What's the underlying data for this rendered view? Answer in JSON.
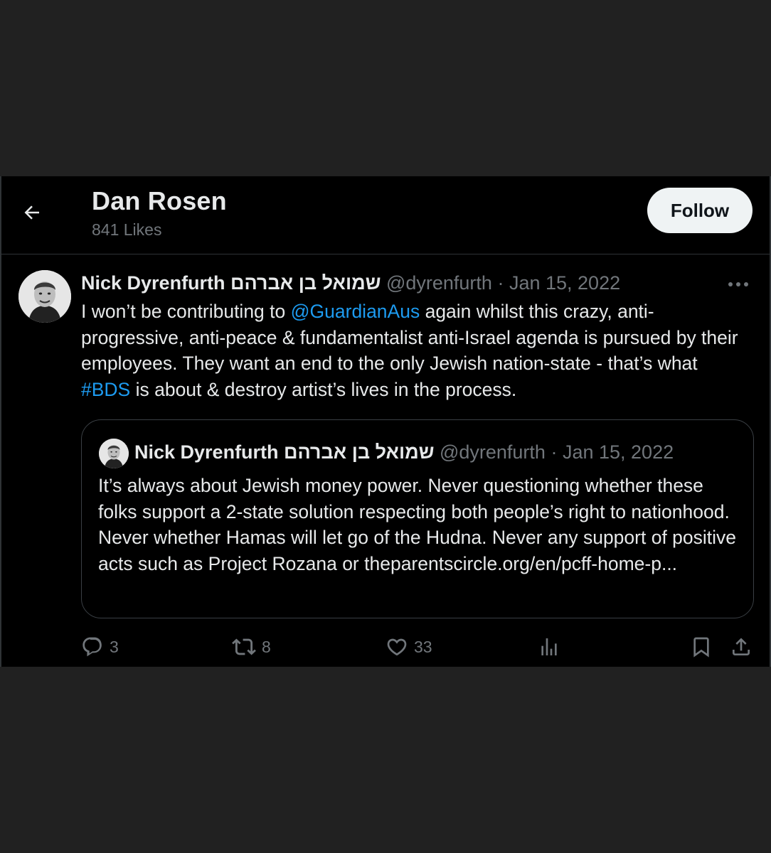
{
  "header": {
    "title": "Dan Rosen",
    "subtitle": "841 Likes",
    "follow_label": "Follow"
  },
  "tweet": {
    "author_name": "Nick Dyrenfurth שמואל בן אברהם",
    "handle": "@dyrenfurth",
    "separator": "·",
    "date": "Jan 15, 2022",
    "text_parts": {
      "p1": "I won’t be contributing to ",
      "mention": "@GuardianAus",
      "p2": "  again whilst this crazy, anti-progressive, anti-peace & fundamentalist anti-Israel agenda is pursued by their employees. They want an end to the only Jewish nation-state - that’s what ",
      "hashtag": "#BDS",
      "p3": " is about & destroy artist’s lives in the process."
    }
  },
  "quote": {
    "author_name": "Nick Dyrenfurth שמואל בן אברהם",
    "handle": "@dyrenfurth",
    "separator": "·",
    "date": "Jan 15, 2022",
    "text": "It’s always about Jewish money power. Never questioning whether these folks support a 2-state solution respecting both people’s right to nationhood. Never whether Hamas will let go of the Hudna. Never any support of positive acts such as Project Rozana or theparentscircle.org/en/pcff-home-p..."
  },
  "actions": {
    "replies": "3",
    "reposts": "8",
    "likes": "33"
  },
  "icons": [
    "back-arrow-icon",
    "more-icon",
    "reply-icon",
    "repost-icon",
    "like-icon",
    "views-icon",
    "bookmark-icon",
    "share-icon"
  ],
  "colors": {
    "background": "#000000",
    "outer_background": "#212121",
    "text": "#e7e9ea",
    "muted": "#71767b",
    "link": "#1d9bf0",
    "follow_button_bg": "#eff3f4"
  }
}
